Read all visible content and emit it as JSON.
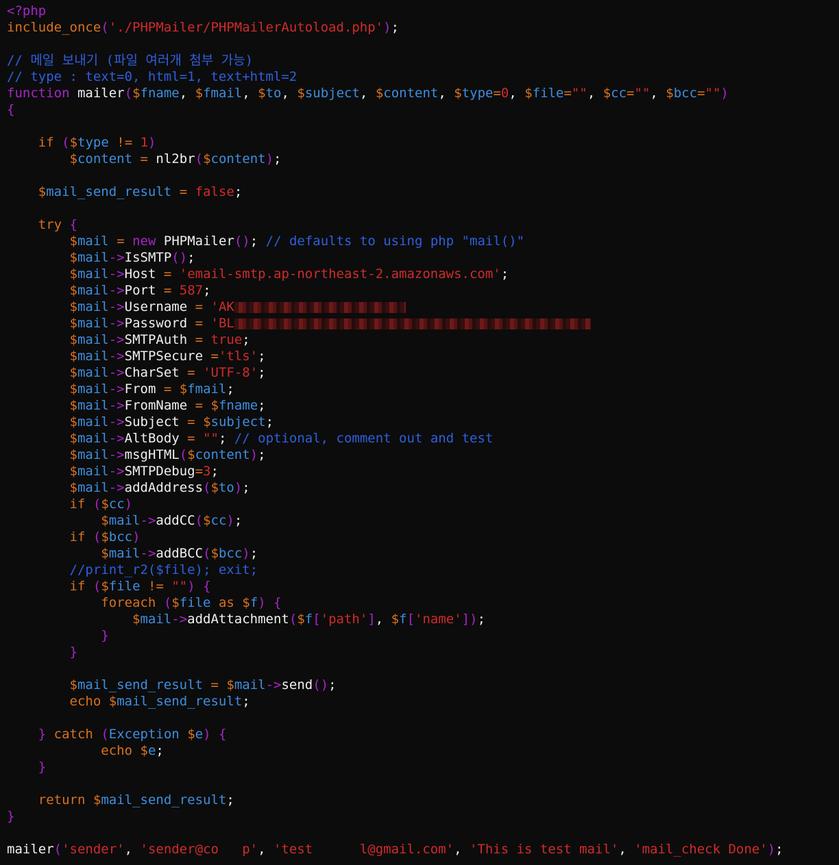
{
  "editor": {
    "lines": [
      "<?php",
      "include_once('./PHPMailer/PHPMailerAutoload.php');",
      "",
      "// 메일 보내기 (파일 여러개 첨부 가능)",
      "// type : text=0, html=1, text+html=2",
      "function mailer($fname, $fmail, $to, $subject, $content, $type=0, $file=\"\", $cc=\"\", $bcc=\"\")",
      "{",
      "",
      "    if ($type != 1)",
      "        $content = nl2br($content);",
      "",
      "    $mail_send_result = false;",
      "",
      "    try {",
      "        $mail = new PHPMailer(); // defaults to using php \"mail()\"",
      "        $mail->IsSMTP();",
      "        $mail->Host = 'email-smtp.ap-northeast-2.amazonaws.com';",
      "        $mail->Port = 587;",
      "        $mail->Username = 'AK",
      "        $mail->Password = 'BL",
      "        $mail->SMTPAuth = true;",
      "        $mail->SMTPSecure ='tls';",
      "        $mail->CharSet = 'UTF-8';",
      "        $mail->From = $fmail;",
      "        $mail->FromName = $fname;",
      "        $mail->Subject = $subject;",
      "        $mail->AltBody = \"\"; // optional, comment out and test",
      "        $mail->msgHTML($content);",
      "        $mail->SMTPDebug=3;",
      "        $mail->addAddress($to);",
      "        if ($cc)",
      "            $mail->addCC($cc);",
      "        if ($bcc)",
      "            $mail->addBCC($bcc);",
      "        //print_r2($file); exit;",
      "        if ($file != \"\") {",
      "            foreach ($file as $f) {",
      "                $mail->addAttachment($f['path'], $f['name']);",
      "            }",
      "        }",
      "",
      "        $mail_send_result = $mail->send();",
      "        echo $mail_send_result;",
      "",
      "    } catch (Exception $e) {",
      "            echo $e;",
      "    }",
      "",
      "    return $mail_send_result;",
      "}",
      "",
      "mailer('sender', 'sender@co   p', 'test      l@gmail.com', 'This is test mail', 'mail_check Done');"
    ]
  },
  "colors": {
    "background": "#0c0c0c",
    "keyword": "#a626c9",
    "control": "#d9711f",
    "variable": "#3e8ee0",
    "string": "#d12b2b",
    "comment": "#2f5fdc",
    "text": "#f0f0f0"
  }
}
